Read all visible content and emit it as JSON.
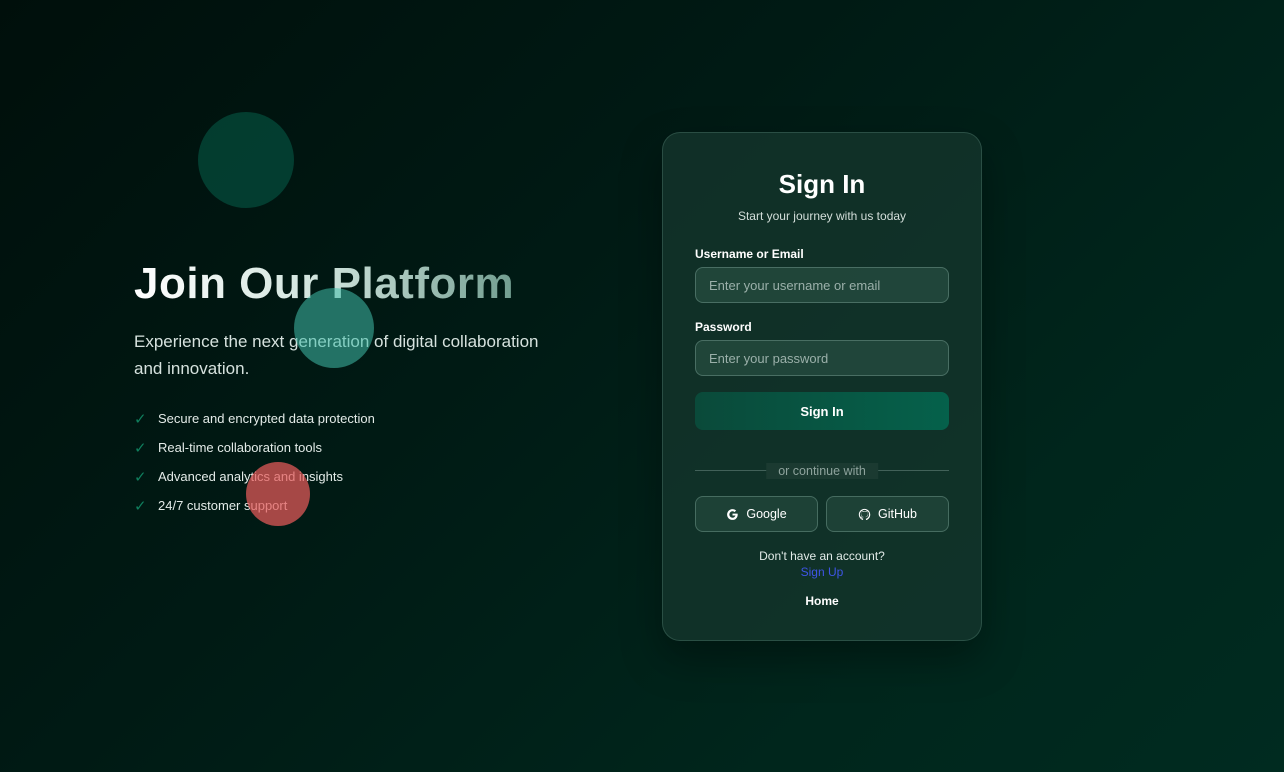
{
  "hero": {
    "title": "Join Our Platform",
    "subtitle": "Experience the next generation of digital collaboration and innovation.",
    "features": [
      "Secure and encrypted data protection",
      "Real-time collaboration tools",
      "Advanced analytics and insights",
      "24/7 customer support"
    ],
    "check_icon": "✓"
  },
  "form": {
    "title": "Sign In",
    "subtitle": "Start your journey with us today",
    "username_label": "Username or Email",
    "username_placeholder": "Enter your username or email",
    "password_label": "Password",
    "password_placeholder": "Enter your password",
    "submit_label": "Sign In",
    "divider_text": "or continue with",
    "google_label": "Google",
    "github_label": "GitHub",
    "account_prompt": "Don't have an account?",
    "signup_label": "Sign Up",
    "home_label": "Home"
  },
  "icons": {
    "google": "google-icon",
    "github": "github-icon",
    "check": "check-icon"
  },
  "colors": {
    "accent": "#05614b",
    "link": "#3e55e6",
    "check": "#0f7e5d"
  }
}
